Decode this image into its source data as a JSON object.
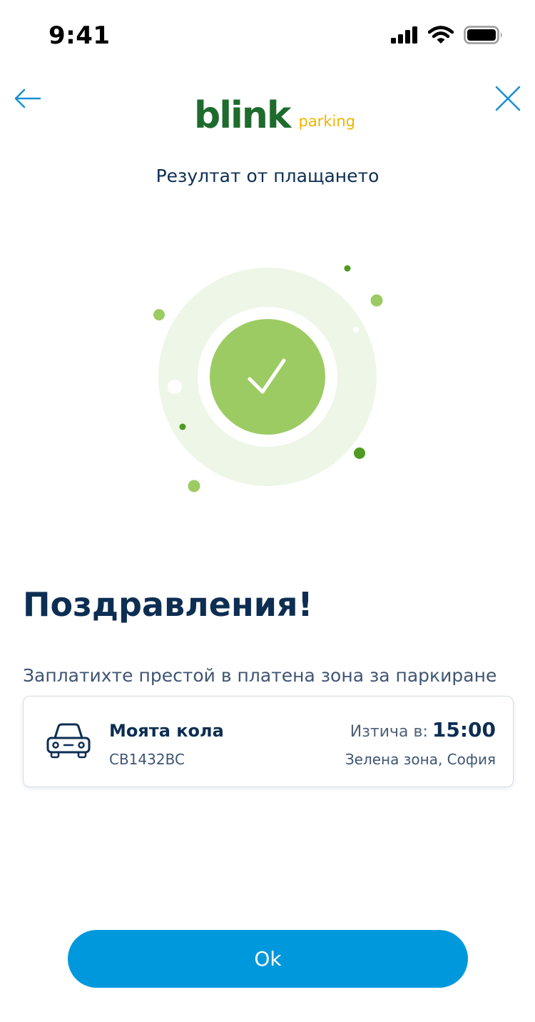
{
  "status_bar": {
    "time": "9:41"
  },
  "header": {
    "logo_main": "blink",
    "logo_sub": "parking",
    "title": "Резултат от плащането"
  },
  "result": {
    "heading": "Поздравления!",
    "message": "Заплатихте престой в платена зона за паркиране"
  },
  "parking": {
    "car_name": "Моята кола",
    "plate": "CB1432BC",
    "expires_label": "Изтича в:",
    "expires_time": "15:00",
    "zone": "Зелена зона, София"
  },
  "actions": {
    "ok_label": "Ok"
  },
  "colors": {
    "brand_green": "#1e6b2d",
    "brand_yellow": "#f0b500",
    "primary_blue": "#0098dc",
    "navy_text": "#0d2e52",
    "success_green": "#9ccb63"
  },
  "icons": {
    "back": "arrow-left-icon",
    "close": "close-icon",
    "success": "checkmark-icon",
    "car": "car-icon",
    "signal": "cellular-signal-icon",
    "wifi": "wifi-icon",
    "battery": "battery-icon"
  }
}
